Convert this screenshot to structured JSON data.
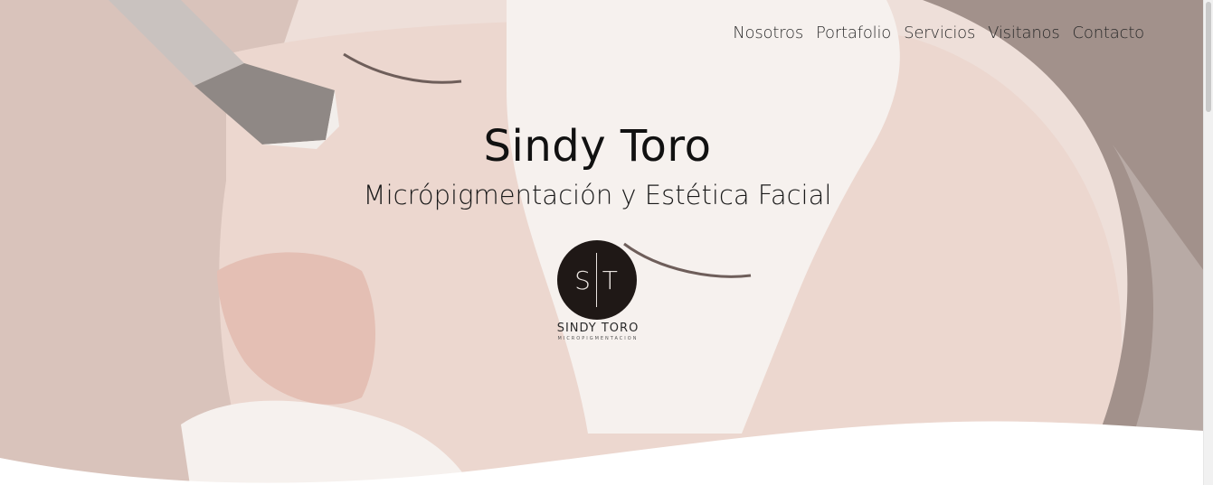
{
  "nav": {
    "items": [
      "Nosotros",
      "Portafolio",
      "Servicios",
      "Visitanos",
      "Contacto"
    ]
  },
  "hero": {
    "title": "Sindy Toro",
    "subtitle": "Micrópigmentación y Estética Facial"
  },
  "logo": {
    "monogram": "S T",
    "name": "SINDY TORO",
    "tagline": "MICROPIGMENTACION"
  },
  "colors": {
    "overlay": "#f3ebe8",
    "skin": "#e8cfc6",
    "mask": "#f7f4f1",
    "hair": "#9a8b86",
    "logo_circle": "#1f1816"
  },
  "icons": [
    "brush-icon"
  ]
}
